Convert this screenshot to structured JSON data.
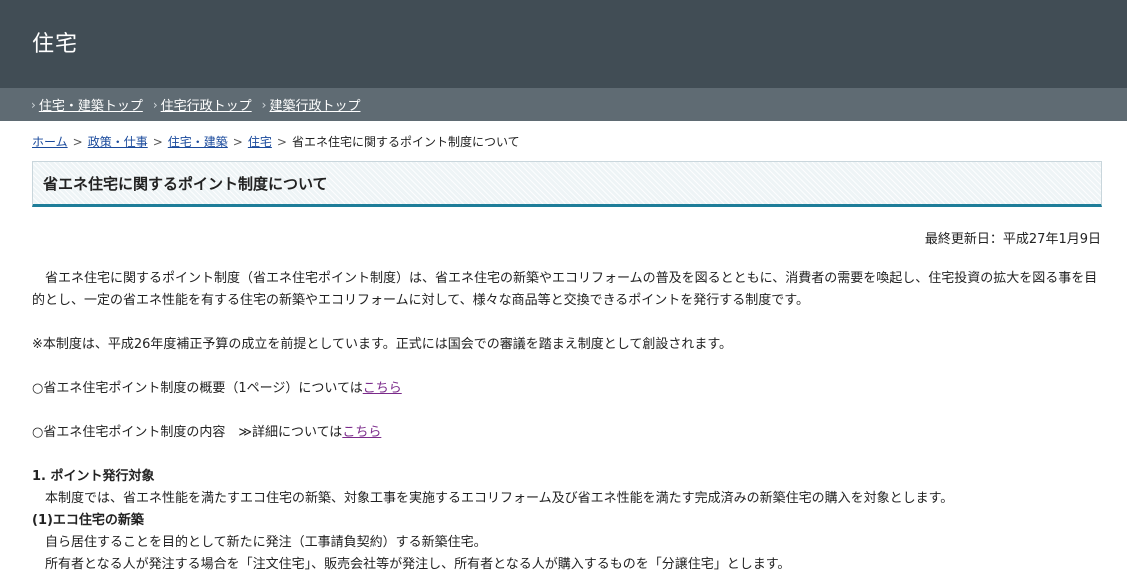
{
  "header": {
    "title": "住宅"
  },
  "subnav": {
    "items": [
      {
        "label": "住宅・建築トップ"
      },
      {
        "label": "住宅行政トップ"
      },
      {
        "label": "建築行政トップ"
      }
    ]
  },
  "breadcrumb": {
    "items": [
      {
        "label": "ホーム"
      },
      {
        "label": "政策・仕事"
      },
      {
        "label": "住宅・建築"
      },
      {
        "label": "住宅"
      }
    ],
    "current": "省エネ住宅に関するポイント制度について",
    "separator": ">"
  },
  "page": {
    "title": "省エネ住宅に関するポイント制度について",
    "updated": "最終更新日：平成27年1月9日"
  },
  "body": {
    "intro": "　省エネ住宅に関するポイント制度（省エネ住宅ポイント制度）は、省エネ住宅の新築やエコリフォームの普及を図るとともに、消費者の需要を喚起し、住宅投資の拡大を図る事を目的とし、一定の省エネ性能を有する住宅の新築やエコリフォームに対して、様々な商品等と交換できるポイントを発行する制度です。",
    "note": "※本制度は、平成26年度補正予算の成立を前提としています。正式には国会での審議を踏まえ制度として創設されます。",
    "overview_text": "○省エネ住宅ポイント制度の概要（1ページ）については",
    "overview_link": "こちら",
    "detail_text": "○省エネ住宅ポイント制度の内容　≫詳細については",
    "detail_link": "こちら",
    "section1_heading": "1. ポイント発行対象",
    "section1_text": "　本制度では、省エネ性能を満たすエコ住宅の新築、対象工事を実施するエコリフォーム及び省エネ性能を満たす完成済みの新築住宅の購入を対象とします。",
    "sub1_heading": "(1)エコ住宅の新築",
    "sub1_line1": "　自ら居住することを目的として新たに発注（工事請負契約）する新築住宅。",
    "sub1_line2": "　所有者となる人が発注する場合を「注文住宅」、販売会社等が発注し、所有者となる人が購入するものを「分譲住宅」とします。"
  },
  "colors": {
    "header_bg": "#414d55",
    "subnav_bg": "#5f6b73",
    "title_accent": "#1e7d99",
    "link": "#1a4a9c",
    "visited_link": "#7a2a8a"
  }
}
